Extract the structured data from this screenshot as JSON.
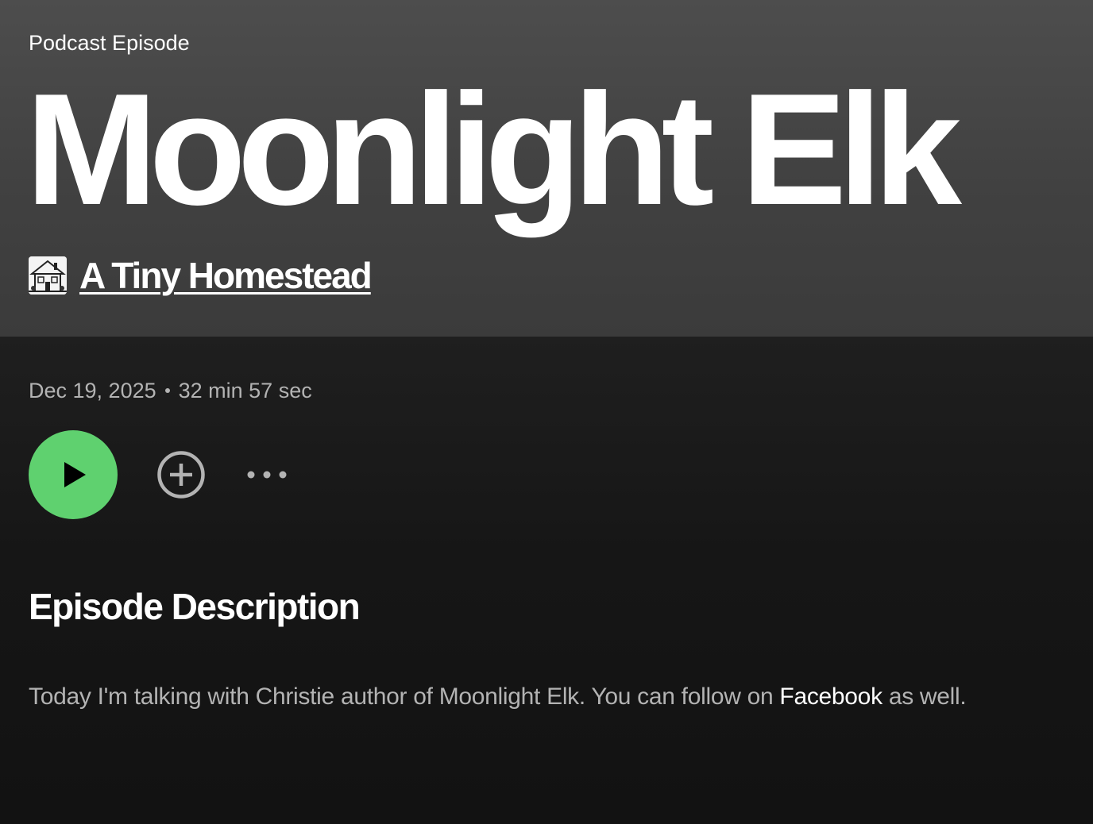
{
  "header": {
    "eyebrow": "Podcast Episode",
    "title": "Moonlight Elk",
    "show_name": "A Tiny Homestead"
  },
  "meta": {
    "date": "Dec 19, 2025",
    "duration": "32 min 57 sec"
  },
  "controls": {
    "play_icon": "play-icon",
    "add_icon": "plus-circle-icon",
    "more_icon": "more-horizontal-icon"
  },
  "description": {
    "heading": "Episode Description",
    "text_before": "Today I'm talking with Christie author of Moonlight Elk. You can follow on ",
    "link_text": "Facebook",
    "text_after": " as well."
  },
  "colors": {
    "accent_green": "#5fd16f",
    "text_primary": "#ffffff",
    "text_secondary": "#b3b3b3",
    "background": "#121212"
  }
}
